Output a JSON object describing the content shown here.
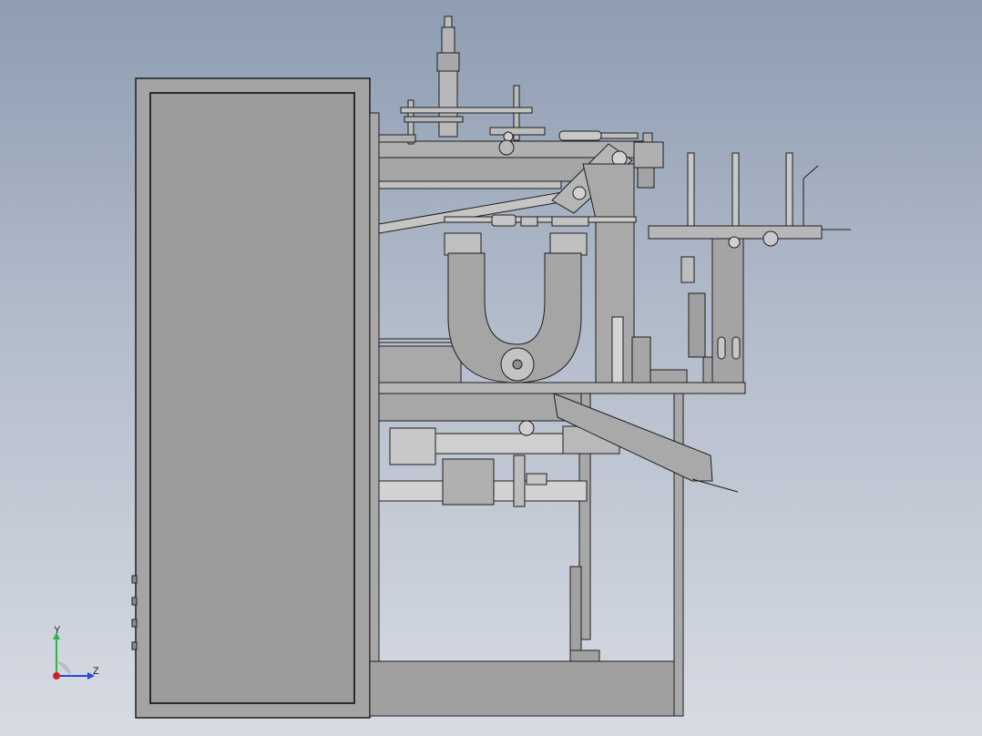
{
  "view": {
    "background_top": "#8e9db2",
    "background_bottom": "#d7dbe3",
    "part_fill": "#a3a3a3",
    "part_fill_light": "#c4c4c4",
    "part_edge": "#1e1e1e"
  },
  "triad": {
    "x_label": "",
    "y_label": "Y",
    "z_label": "Z",
    "y_color": "#2fb34a",
    "z_color": "#2a44d6",
    "x_color": "#d11f1f"
  }
}
